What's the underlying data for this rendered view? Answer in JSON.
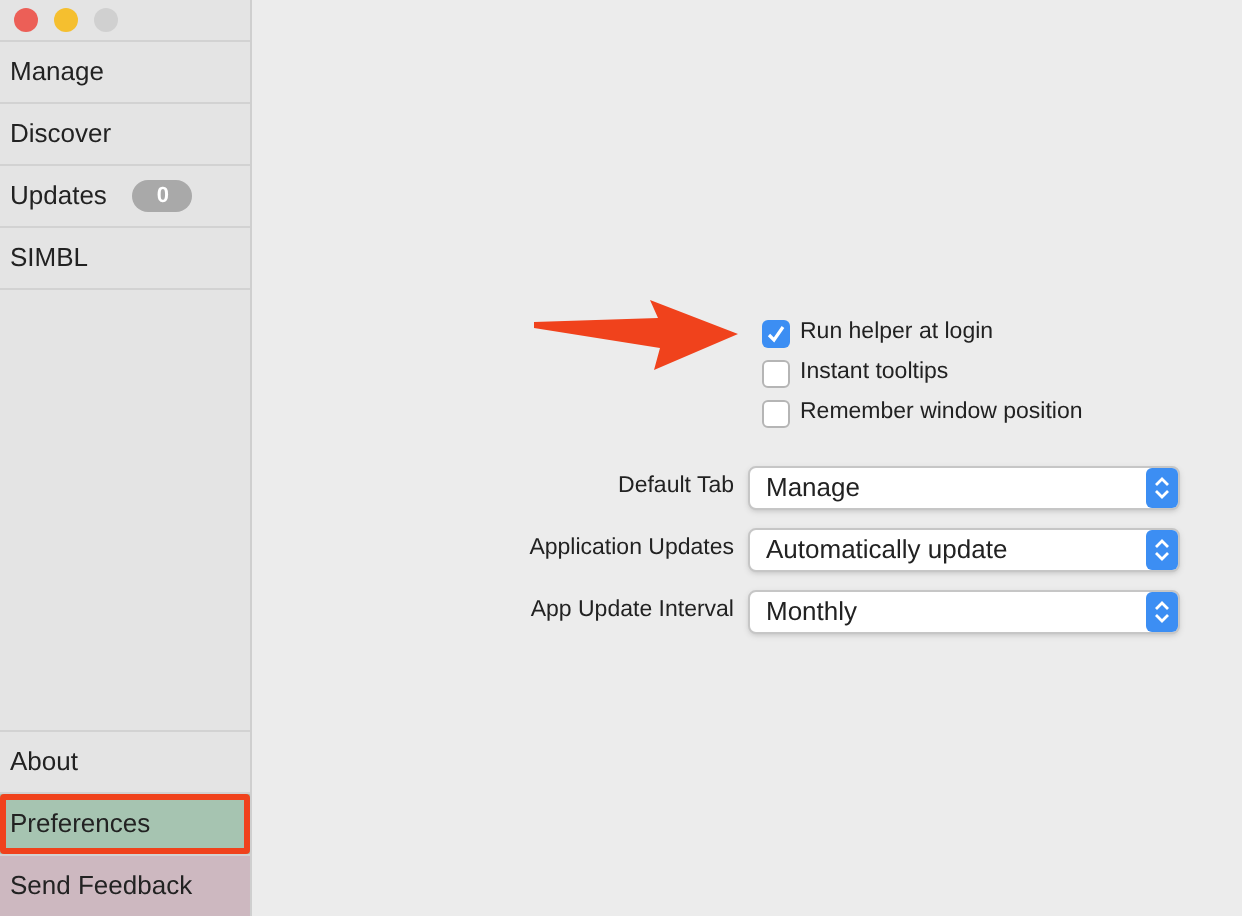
{
  "window": {
    "controls": [
      {
        "kind": "close"
      },
      {
        "kind": "minimize"
      },
      {
        "kind": "zoom"
      }
    ]
  },
  "sidebar": {
    "items": [
      {
        "label": "Manage",
        "selected": false
      },
      {
        "label": "Discover",
        "selected": false
      },
      {
        "label": "Updates",
        "selected": false,
        "badge": "0"
      },
      {
        "label": "SIMBL",
        "selected": false
      }
    ],
    "bottom_items": [
      {
        "label": "About",
        "selected": false,
        "kind": "plain",
        "annotated": false
      },
      {
        "label": "Preferences",
        "selected": true,
        "kind": "plain",
        "annotated": true
      },
      {
        "label": "Send Feedback",
        "selected": false,
        "kind": "feedback",
        "annotated": false
      }
    ]
  },
  "preferences": {
    "checkboxes": [
      {
        "label": "Run helper at login",
        "checked": true,
        "annotated": true
      },
      {
        "label": "Instant tooltips",
        "checked": false,
        "annotated": false
      },
      {
        "label": "Remember window position",
        "checked": false,
        "annotated": false
      }
    ],
    "selects": [
      {
        "label": "Default Tab",
        "value": "Manage"
      },
      {
        "label": "Application Updates",
        "value": "Automatically update"
      },
      {
        "label": "App Update Interval",
        "value": "Monthly"
      }
    ]
  }
}
